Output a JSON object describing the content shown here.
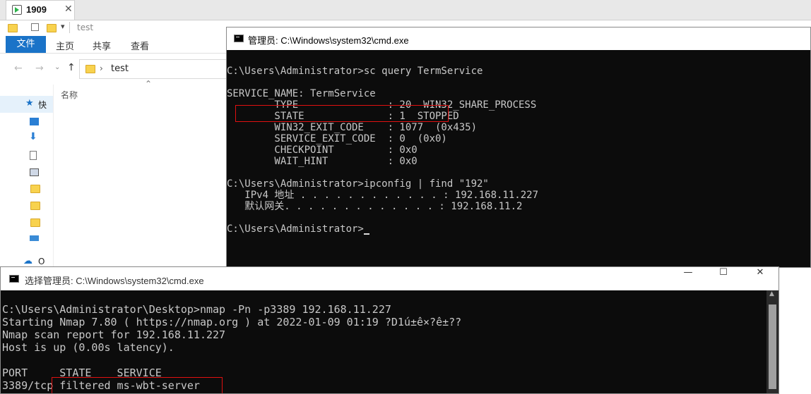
{
  "explorer": {
    "tab_title": "1909",
    "tab_close": "✕",
    "qat_path": "test",
    "ribbon_tabs": [
      "文件",
      "主页",
      "共享",
      "查看"
    ],
    "address_folder": "test",
    "column_name": "名称",
    "nav_items": [
      "快",
      "",
      "",
      "",
      "",
      "",
      "",
      "",
      "",
      "",
      "O"
    ]
  },
  "cmd1": {
    "title": "管理员: C:\\Windows\\system32\\cmd.exe",
    "lines": [
      "",
      "C:\\Users\\Administrator>sc query TermService",
      "",
      "SERVICE_NAME: TermService",
      "        TYPE               : 20  WIN32_SHARE_PROCESS",
      "        STATE              : 1  STOPPED",
      "        WIN32_EXIT_CODE    : 1077  (0x435)",
      "        SERVICE_EXIT_CODE  : 0  (0x0)",
      "        CHECKPOINT         : 0x0",
      "        WAIT_HINT          : 0x0",
      "",
      "C:\\Users\\Administrator>ipconfig | find \"192\"",
      "   IPv4 地址 . . . . . . . . . . . . : 192.168.11.227",
      "   默认网关. . . . . . . . . . . . . : 192.168.11.2",
      "",
      "C:\\Users\\Administrator>"
    ]
  },
  "cmd2": {
    "title": "选择管理员: C:\\Windows\\system32\\cmd.exe",
    "minimize": "—",
    "maximize": "☐",
    "close": "✕",
    "lines": [
      "",
      "C:\\Users\\Administrator\\Desktop>nmap -Pn -p3389 192.168.11.227",
      "Starting Nmap 7.80 ( https://nmap.org ) at 2022-01-09 01:19 ?D1ú±ê×?ê±??",
      "Nmap scan report for 192.168.11.227",
      "Host is up (0.00s latency).",
      "",
      "PORT     STATE    SERVICE",
      "3389/tcp filtered ms-wbt-server"
    ]
  }
}
